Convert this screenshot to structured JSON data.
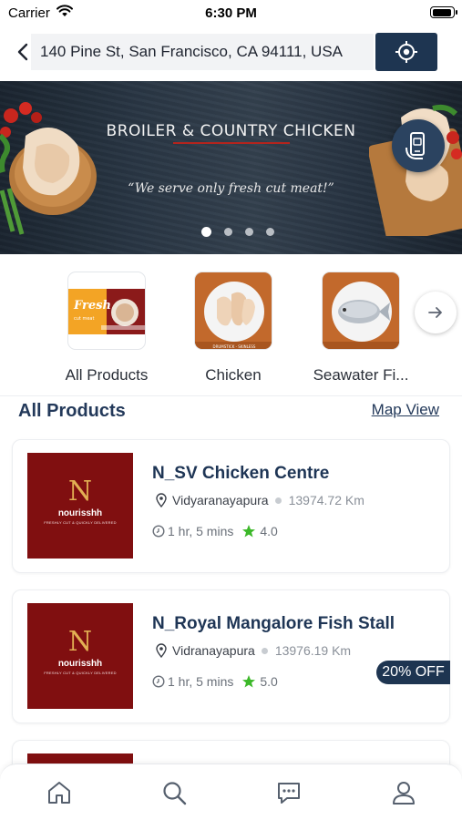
{
  "status_bar": {
    "carrier": "Carrier",
    "time": "6:30 PM",
    "battery_level": 0.95
  },
  "address_bar": {
    "address": "140 Pine St, San Francisco, CA 94111, USA",
    "back_icon": "chevron-left-icon",
    "locate_icon": "gps-target-icon"
  },
  "banner": {
    "title": "BROILER & COUNTRY CHICKEN",
    "tagline": "“We serve only fresh cut meat!”",
    "slide_count": 4,
    "active_slide": 1,
    "floating_icon": "mobile-order-icon"
  },
  "categories": [
    {
      "label": "All Products"
    },
    {
      "label": "Chicken"
    },
    {
      "label": "Seawater Fi..."
    }
  ],
  "categories_next_icon": "arrow-right-icon",
  "section": {
    "title": "All Products",
    "map_view": "Map View"
  },
  "stores": [
    {
      "name": "N_SV Chicken Centre",
      "area": "Vidyaranayapura",
      "distance": "13974.72 Km",
      "time": "1 hr, 5 mins",
      "rating": "4.0",
      "logo": {
        "letter": "N",
        "brand": "nourisshh",
        "tagline": "FRESHLY CUT & QUICKLY DELIVERED"
      }
    },
    {
      "name": "N_Royal Mangalore Fish Stall",
      "area": "Vidranayapura",
      "distance": "13976.19 Km",
      "time": "1 hr, 5 mins",
      "rating": "5.0",
      "offer": "20% OFF",
      "logo": {
        "letter": "N",
        "brand": "nourisshh",
        "tagline": "FRESHLY CUT & QUICKLY DELIVERED"
      }
    }
  ],
  "bottom_nav": [
    "home-icon",
    "search-icon",
    "chat-icon",
    "profile-icon"
  ],
  "colors": {
    "primary": "#1e3551",
    "brand_red": "#800f10",
    "star": "#3cb829"
  }
}
